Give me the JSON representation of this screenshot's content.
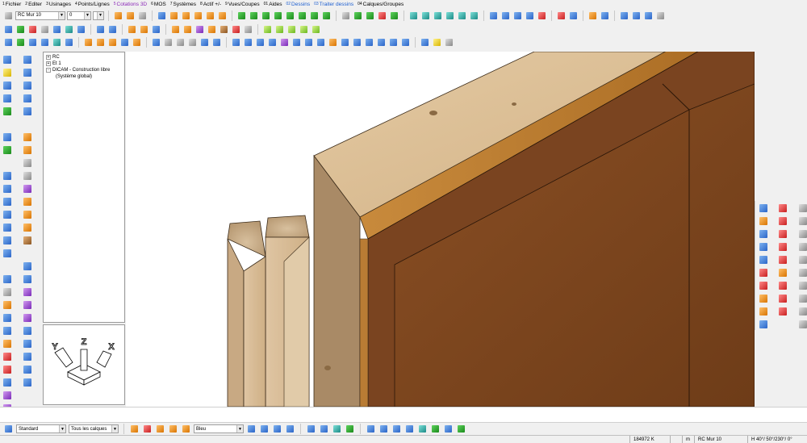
{
  "menu": [
    {
      "num": "1",
      "label": "Fichier",
      "color": "#000000"
    },
    {
      "num": "2",
      "label": "Editer",
      "color": "#000000"
    },
    {
      "num": "3",
      "label": "Usinages",
      "color": "#000000"
    },
    {
      "num": "4",
      "label": "Points/Lignes",
      "color": "#000000"
    },
    {
      "num": "5",
      "label": "Cotations 3D",
      "color": "#8b2ab8"
    },
    {
      "num": "6",
      "label": "MOS",
      "color": "#000000"
    },
    {
      "num": "7",
      "label": "Systèmes",
      "color": "#000000"
    },
    {
      "num": "8",
      "label": "Actif +/-",
      "color": "#000000"
    },
    {
      "num": "9",
      "label": "Vues/Coupes",
      "color": "#000000"
    },
    {
      "num": "01",
      "label": "Aides",
      "color": "#000000"
    },
    {
      "num": "02",
      "label": "Dessins",
      "color": "#1e5fd0"
    },
    {
      "num": "03",
      "label": "Traiter dessins",
      "color": "#1e5fd0"
    },
    {
      "num": "04",
      "label": "Calques/Groupes",
      "color": "#000000"
    }
  ],
  "toolbar": {
    "element_combo": "RC Mur 10",
    "level_combo": "0",
    "small_combo": ""
  },
  "tree": {
    "items": [
      {
        "label": "RC",
        "expander": "+"
      },
      {
        "label": "Et 1",
        "expander": "+"
      },
      {
        "label": "DICAM - Construction libre",
        "expander": "-"
      },
      {
        "label": "(Système global)",
        "expander": ""
      }
    ]
  },
  "axis": {
    "x": "X",
    "y": "Y",
    "z": "Z"
  },
  "bottom": {
    "layer_style": "Standard",
    "layers": "Tous les calques",
    "color": "Bleu"
  },
  "status": {
    "coordinate": "184972 K",
    "unit": "m",
    "element": "RC Mur 10",
    "view": "H 40°/ 50°/230°/ 0°"
  },
  "icons": {
    "toolbar": [
      "orange-box-icon",
      "sphere-icon",
      "wall-green-icon",
      "window-icon",
      "layer-icon"
    ],
    "left": [
      "new-doc-icon",
      "open-folder-icon",
      "save-icon",
      "undo-icon",
      "redo-icon",
      "move-icon",
      "rotate-icon",
      "copy-icon",
      "mirror-icon",
      "delete-icon",
      "chart-icon",
      "house-icon",
      "roof-icon",
      "print-icon",
      "export-icon"
    ],
    "right": [
      "select-icon",
      "cross-red-icon",
      "beam-icon",
      "database-icon",
      "house-outline-icon",
      "roof-outline-icon"
    ]
  }
}
